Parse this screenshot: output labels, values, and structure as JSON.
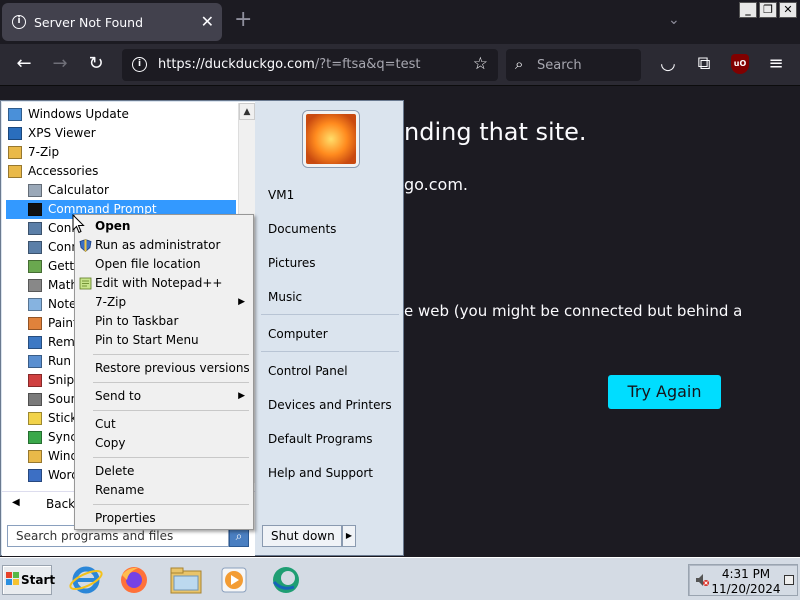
{
  "browser": {
    "tab_title": "Server Not Found",
    "url_host": "https://duckduckgo.com",
    "url_rest": "/?t=ftsa&q=test",
    "search_placeholder": "Search",
    "ublock_label": "uO"
  },
  "page": {
    "heading": "nding that site.",
    "subtext": "go.com.",
    "body": "e web (you might be connected but behind a",
    "try_again": "Try Again"
  },
  "start_menu": {
    "programs": [
      {
        "label": "Windows Update",
        "icon": "windows-update-icon",
        "indent": false,
        "selected": false
      },
      {
        "label": "XPS Viewer",
        "icon": "xps-viewer-icon",
        "indent": false,
        "selected": false
      },
      {
        "label": "7-Zip",
        "icon": "folder-icon",
        "indent": false,
        "selected": false
      },
      {
        "label": "Accessories",
        "icon": "folder-icon",
        "indent": false,
        "selected": false
      },
      {
        "label": "Calculator",
        "icon": "calculator-icon",
        "indent": true,
        "selected": false
      },
      {
        "label": "Command Prompt",
        "icon": "command-prompt-icon",
        "indent": true,
        "selected": true
      },
      {
        "label": "Conn",
        "icon": "connect-icon",
        "indent": true,
        "selected": false
      },
      {
        "label": "Conn",
        "icon": "connect-icon",
        "indent": true,
        "selected": false
      },
      {
        "label": "Getti",
        "icon": "getting-started-icon",
        "indent": true,
        "selected": false
      },
      {
        "label": "Math",
        "icon": "math-input-icon",
        "indent": true,
        "selected": false
      },
      {
        "label": "Note",
        "icon": "notepad-icon",
        "indent": true,
        "selected": false
      },
      {
        "label": "Paint",
        "icon": "paint-icon",
        "indent": true,
        "selected": false
      },
      {
        "label": "Remo",
        "icon": "remote-desktop-icon",
        "indent": true,
        "selected": false
      },
      {
        "label": "Run",
        "icon": "run-icon",
        "indent": true,
        "selected": false
      },
      {
        "label": "Snipp",
        "icon": "snipping-tool-icon",
        "indent": true,
        "selected": false
      },
      {
        "label": "Soun",
        "icon": "sound-recorder-icon",
        "indent": true,
        "selected": false
      },
      {
        "label": "Stick",
        "icon": "sticky-notes-icon",
        "indent": true,
        "selected": false
      },
      {
        "label": "Sync",
        "icon": "sync-center-icon",
        "indent": true,
        "selected": false
      },
      {
        "label": "Wind",
        "icon": "windows-explorer-icon",
        "indent": true,
        "selected": false
      },
      {
        "label": "Word",
        "icon": "wordpad-icon",
        "indent": true,
        "selected": false
      }
    ],
    "back_label": "Back",
    "search_placeholder": "Search programs and files",
    "right_items": {
      "user": "VM1",
      "documents": "Documents",
      "pictures": "Pictures",
      "music": "Music",
      "computer": "Computer",
      "control_panel": "Control Panel",
      "devices": "Devices and Printers",
      "default_programs": "Default Programs",
      "help": "Help and Support"
    },
    "shutdown_label": "Shut down"
  },
  "context_menu": {
    "open": "Open",
    "run_admin": "Run as administrator",
    "open_location": "Open file location",
    "edit_notepad": "Edit with Notepad++",
    "seven_zip": "7-Zip",
    "pin_taskbar": "Pin to Taskbar",
    "pin_start": "Pin to Start Menu",
    "restore": "Restore previous versions",
    "send_to": "Send to",
    "cut": "Cut",
    "copy": "Copy",
    "delete": "Delete",
    "rename": "Rename",
    "properties": "Properties"
  },
  "taskbar": {
    "start_label": "Start",
    "time": "4:31 PM",
    "date": "11/20/2024"
  },
  "colors": {
    "accent": "#00ddff",
    "selection": "#3399ff",
    "page_bg": "#1c1b22"
  }
}
